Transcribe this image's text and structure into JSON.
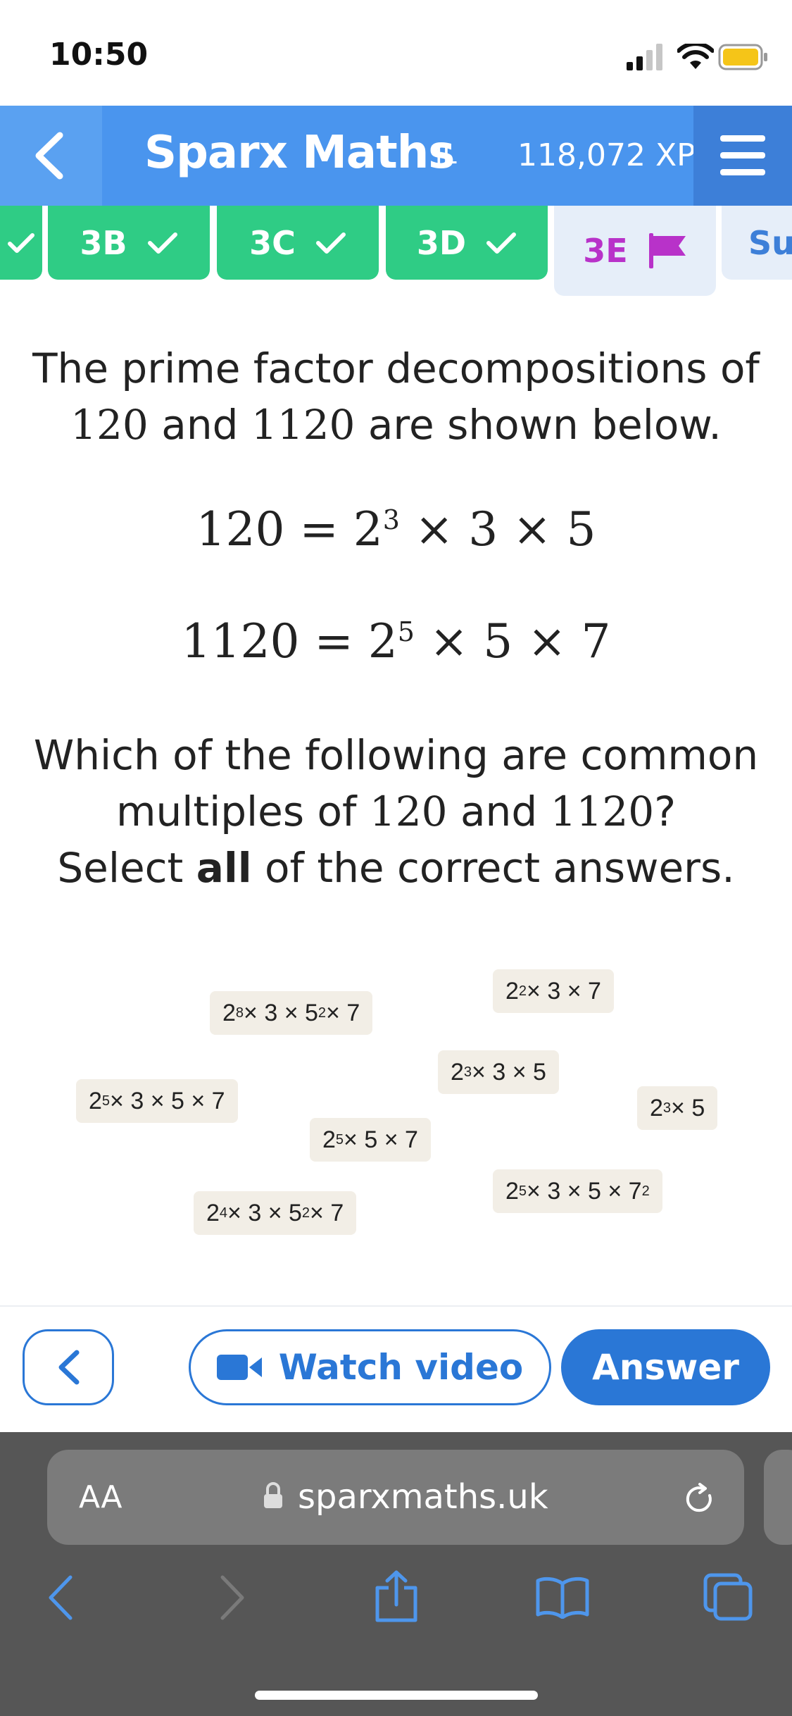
{
  "status_bar": {
    "time": "10:50"
  },
  "header": {
    "brand": "Sparx Maths",
    "level": "IL",
    "xp": "118,072 XP"
  },
  "tabs": [
    {
      "label": "3B",
      "state": "complete"
    },
    {
      "label": "3C",
      "state": "complete"
    },
    {
      "label": "3D",
      "state": "complete"
    },
    {
      "label": "3E",
      "state": "current"
    },
    {
      "label": "Su",
      "state": "next"
    }
  ],
  "question": {
    "intro_line1": "The prime factor decompositions of",
    "intro_line2_num1": "120",
    "intro_line2_and": " and ",
    "intro_line2_num2": "1120",
    "intro_line2_rest": " are shown below.",
    "eq1": {
      "lhs": "120",
      "base": "2",
      "exp": "3",
      "rest": "× 3 × 5"
    },
    "eq2": {
      "lhs": "1120",
      "base": "2",
      "exp": "5",
      "rest": "× 5 × 7"
    },
    "prompt_line1": "Which of the following are common",
    "prompt_line2_a": "multiples of ",
    "prompt_line2_num1": "120",
    "prompt_line2_and": " and ",
    "prompt_line2_num2": "1120",
    "prompt_line2_q": "?",
    "select_prefix": "Select ",
    "select_bold": "all",
    "select_suffix": " of the correct answers."
  },
  "options": [
    {
      "id": "o1",
      "html": "2<sup>2</sup> × 3 × 7"
    },
    {
      "id": "o2",
      "html": "2<sup>8</sup> × 3 × 5<sup>2</sup> × 7"
    },
    {
      "id": "o3",
      "html": "2<sup>3</sup> × 3 × 5"
    },
    {
      "id": "o4",
      "html": "2<sup>5</sup> × 3 × 5 × 7"
    },
    {
      "id": "o5",
      "html": "2<sup>3</sup> × 5"
    },
    {
      "id": "o6",
      "html": "2<sup>5</sup> × 5 × 7"
    },
    {
      "id": "o7",
      "html": "2<sup>5</sup> × 3 × 5 × 7<sup>2</sup>"
    },
    {
      "id": "o8",
      "html": "2<sup>4</sup> × 3 × 5<sup>2</sup> × 7"
    }
  ],
  "actions": {
    "watch_video": "Watch video",
    "answer": "Answer"
  },
  "browser": {
    "aa": "AA",
    "url": "sparxmaths.uk"
  },
  "colors": {
    "header": "#4a95ee",
    "tab_complete": "#2fcc85",
    "tab_current_text": "#b832c9",
    "primary": "#2a77d6"
  }
}
